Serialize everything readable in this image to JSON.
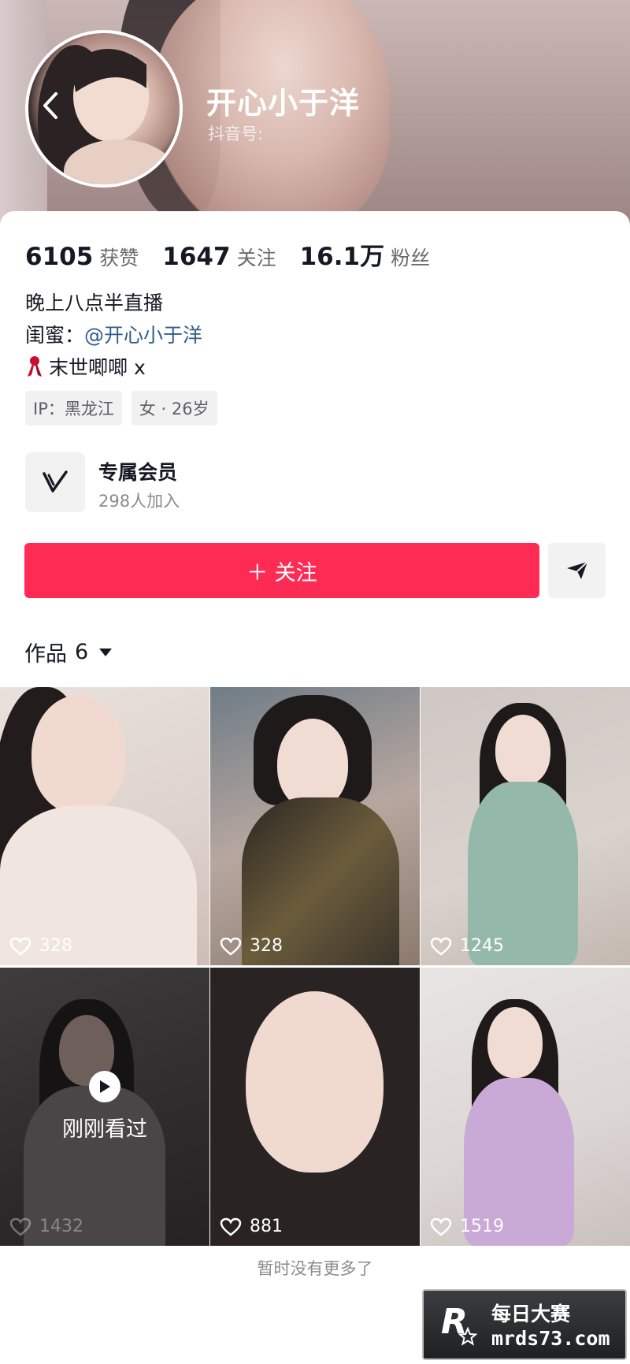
{
  "profile": {
    "name": "开心小于洋",
    "douyin_id_label": "抖音号:"
  },
  "stats": [
    {
      "value": "6105",
      "label": "获赞"
    },
    {
      "value": "1647",
      "label": "关注"
    },
    {
      "value": "16.1万",
      "label": "粉丝"
    }
  ],
  "bio": {
    "line1": "晚上八点半直播",
    "line2_prefix": "闺蜜：",
    "line2_mention": "@开心小于洋",
    "line3": "末世唧唧 x"
  },
  "tags": [
    "IP：黑龙江",
    "女 · 26岁"
  ],
  "member": {
    "title": "专属会员",
    "subtitle": "298人加入"
  },
  "actions": {
    "follow_label": "＋ 关注",
    "follow_color": "#fe2c55"
  },
  "works": {
    "tab_label": "作品",
    "count": "6"
  },
  "videos": [
    {
      "likes": "328"
    },
    {
      "likes": "328"
    },
    {
      "likes": "1245"
    },
    {
      "likes": "1432",
      "overlay": "刚刚看过"
    },
    {
      "likes": "881"
    },
    {
      "likes": "1519"
    }
  ],
  "footer": {
    "no_more": "暂时没有更多了"
  },
  "watermark": {
    "text_cn": "每日大赛",
    "text_url": "mrds73.com",
    "badge": "R"
  },
  "icons": [
    "back-icon",
    "heart-icon",
    "share-icon",
    "vip-logo-icon",
    "play-icon",
    "dropdown-caret-icon",
    "ribbon-emoji-icon"
  ]
}
